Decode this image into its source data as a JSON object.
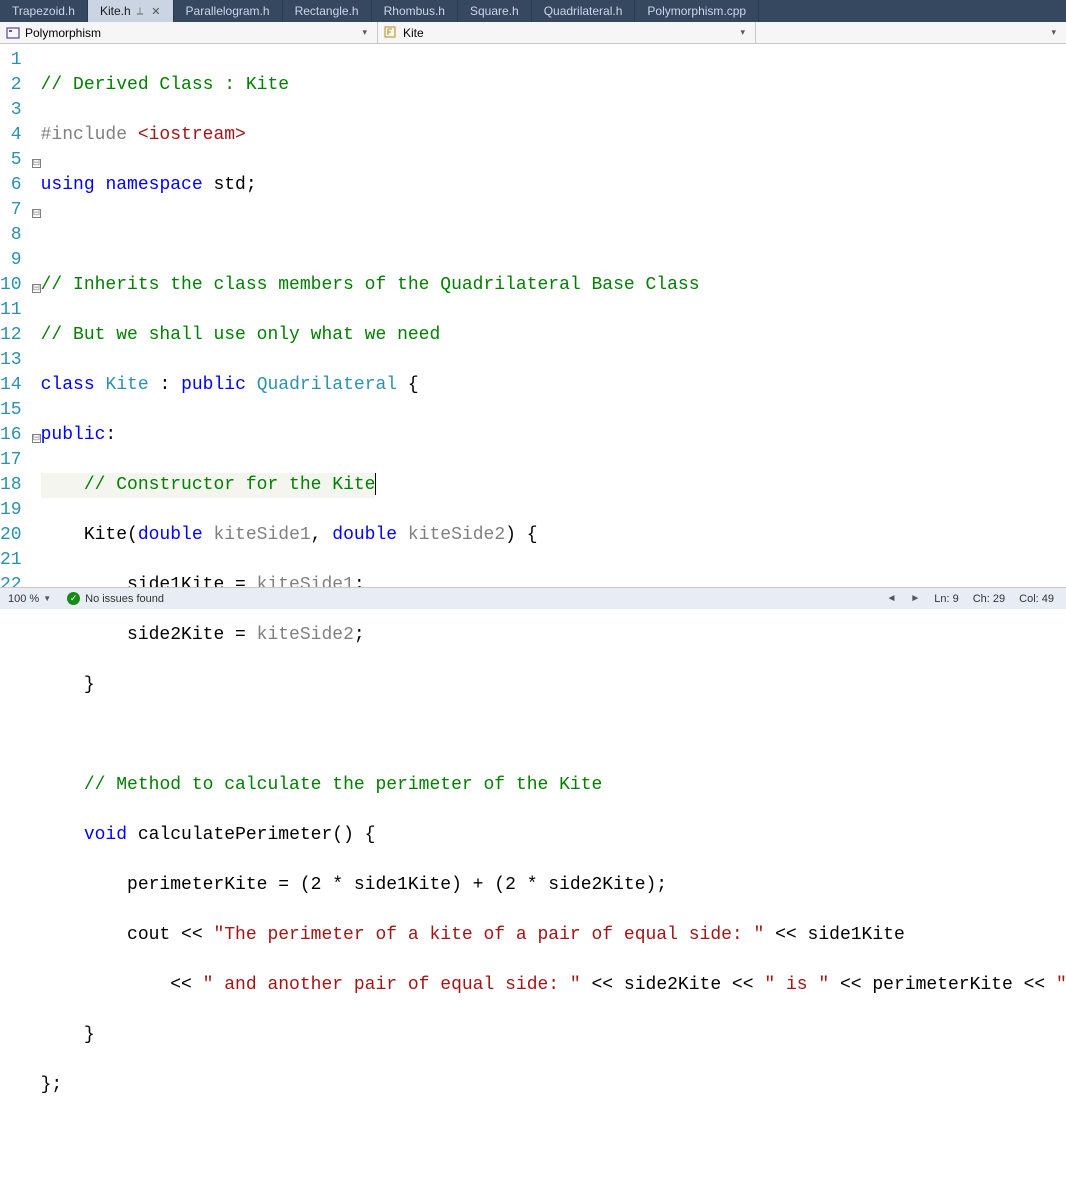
{
  "tabs": [
    {
      "label": "Trapezoid.h",
      "active": false
    },
    {
      "label": "Kite.h",
      "active": true,
      "pinned": true
    },
    {
      "label": "Parallelogram.h",
      "active": false
    },
    {
      "label": "Rectangle.h",
      "active": false
    },
    {
      "label": "Rhombus.h",
      "active": false
    },
    {
      "label": "Square.h",
      "active": false
    },
    {
      "label": "Quadrilateral.h",
      "active": false
    },
    {
      "label": "Polymorphism.cpp",
      "active": false
    }
  ],
  "nav": {
    "scope": "Polymorphism",
    "member": "Kite"
  },
  "lines": [
    "1",
    "2",
    "3",
    "4",
    "5",
    "6",
    "7",
    "8",
    "9",
    "10",
    "11",
    "12",
    "13",
    "14",
    "15",
    "16",
    "17",
    "18",
    "19",
    "20",
    "21",
    "22"
  ],
  "folds": {
    "5": "⊟",
    "7": "⊟",
    "10": "⊟",
    "16": "⊟"
  },
  "code": {
    "l1": {
      "a": "// Derived Class : Kite"
    },
    "l2": {
      "a": "#include ",
      "b": "<iostream>"
    },
    "l3": {
      "a": "using",
      "b": " ",
      "c": "namespace",
      "d": " std;"
    },
    "l5": {
      "a": "// Inherits the class members of the Quadrilateral Base Class"
    },
    "l6": {
      "a": "// But we shall use only what we need"
    },
    "l7": {
      "a": "class",
      "b": " ",
      "c": "Kite",
      "d": " : ",
      "e": "public",
      "f": " ",
      "g": "Quadrilateral",
      "h": " {"
    },
    "l8": {
      "a": "public",
      "b": ":"
    },
    "l9": {
      "a": "    ",
      "b": "// Constructor for the Kite"
    },
    "l10": {
      "a": "    Kite(",
      "b": "double",
      "c": " ",
      "d": "kiteSide1",
      "e": ", ",
      "f": "double",
      "g": " ",
      "h": "kiteSide2",
      "i": ") {"
    },
    "l11": {
      "a": "        side1Kite = ",
      "b": "kiteSide1",
      "c": ";"
    },
    "l12": {
      "a": "        side2Kite = ",
      "b": "kiteSide2",
      "c": ";"
    },
    "l13": {
      "a": "    }"
    },
    "l15": {
      "a": "    ",
      "b": "// Method to calculate the perimeter of the Kite"
    },
    "l16": {
      "a": "    ",
      "b": "void",
      "c": " calculatePerimeter() {"
    },
    "l17": {
      "a": "        perimeterKite = (2 * side1Kite) + (2 * side2Kite);"
    },
    "l18": {
      "a": "        cout << ",
      "b": "\"The perimeter of a kite of a pair of equal side: \"",
      "c": " << side1Kite"
    },
    "l19": {
      "a": "            << ",
      "b": "\" and another pair of equal side: \"",
      "c": " << side2Kite << ",
      "d": "\" is \"",
      "e": " << perimeterKite << ",
      "f": "\"\\n\\n\"",
      "g": ";"
    },
    "l20": {
      "a": "    }"
    },
    "l21": {
      "a": "};"
    }
  },
  "status": {
    "zoom": "100 %",
    "issues": "No issues found",
    "ln": "Ln: 9",
    "ch": "Ch: 29",
    "col": "Col: 49"
  }
}
